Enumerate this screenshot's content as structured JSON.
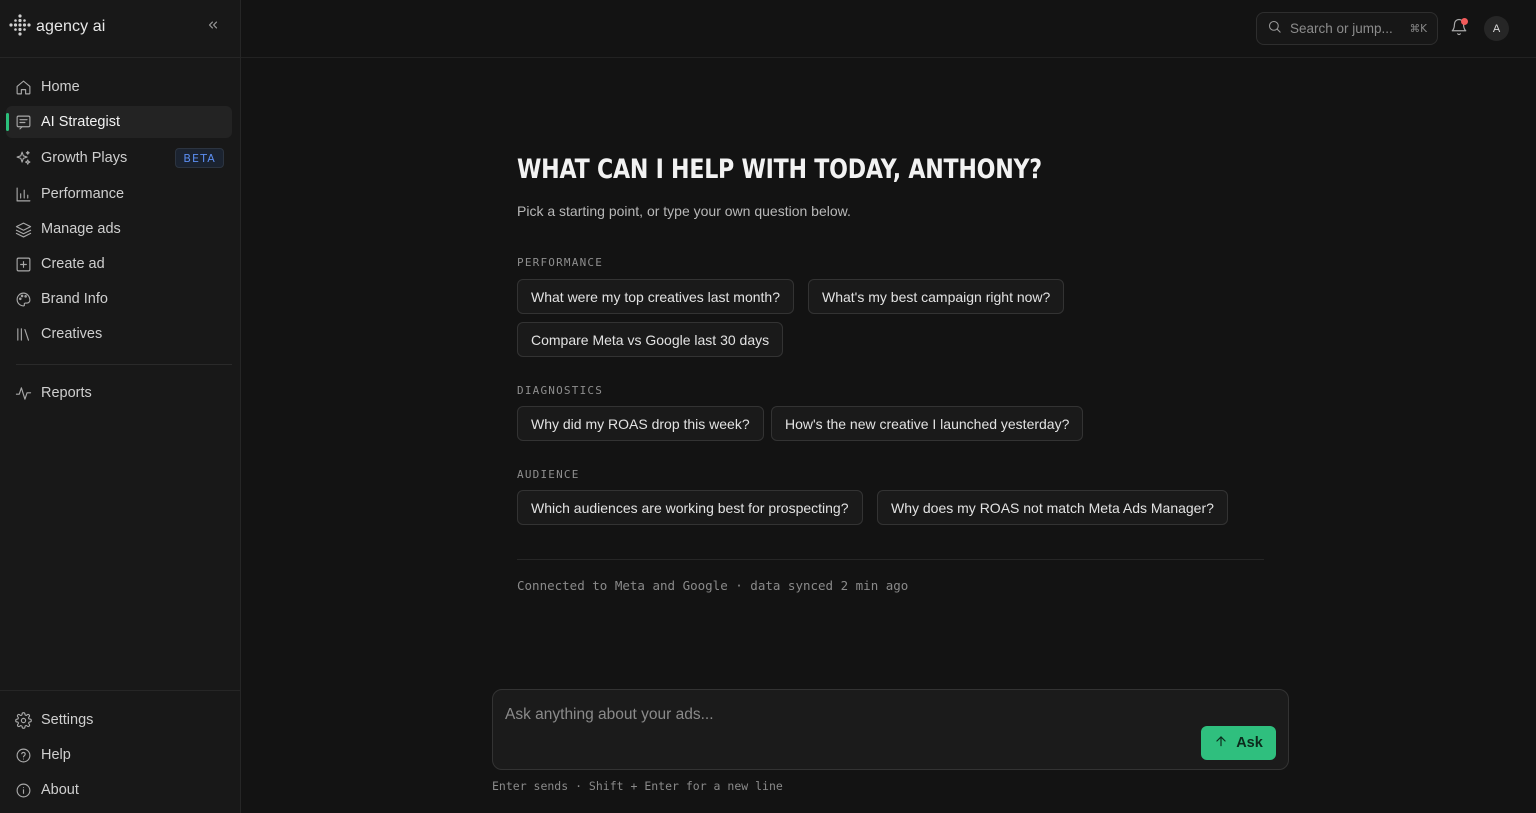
{
  "brand": {
    "name": "agency ai",
    "logo_icon": "dots-grid-logo"
  },
  "sidebar": {
    "collapse_icon": "chevrons-left-icon",
    "items": [
      {
        "label": "Home",
        "icon": "home-icon"
      },
      {
        "label": "AI Strategist",
        "icon": "chat-icon",
        "active": true
      },
      {
        "label": "Growth Plays",
        "icon": "sparkles-icon",
        "badge": "BETA"
      },
      {
        "label": "Performance",
        "icon": "bar-chart-icon"
      },
      {
        "label": "Manage ads",
        "icon": "layers-icon"
      },
      {
        "label": "Create ad",
        "icon": "plus-square-icon"
      },
      {
        "label": "Brand Info",
        "icon": "palette-icon"
      },
      {
        "label": "Creatives",
        "icon": "library-icon"
      },
      {
        "label": "Reports",
        "icon": "activity-icon"
      }
    ],
    "footer_items": [
      {
        "label": "Settings",
        "icon": "gear-icon"
      },
      {
        "label": "Help",
        "icon": "help-circle-icon"
      },
      {
        "label": "About",
        "icon": "info-icon"
      }
    ]
  },
  "topbar": {
    "search_placeholder": "Search or jump...",
    "search_shortcut": "⌘K",
    "avatar_initial": "A"
  },
  "main": {
    "heading": "WHAT CAN I HELP WITH TODAY, ANTHONY?",
    "subheading": "Pick a starting point, or type your own question below.",
    "sections": [
      {
        "label": "PERFORMANCE",
        "prompts": [
          "What were my top creatives last month?",
          "What's my best campaign right now?",
          "Compare Meta vs Google last 30 days"
        ]
      },
      {
        "label": "DIAGNOSTICS",
        "prompts": [
          "Why did my ROAS drop this week?",
          "How's the new creative I launched yesterday?"
        ]
      },
      {
        "label": "AUDIENCE",
        "prompts": [
          "Which audiences are working best for prospecting?",
          "Why does my ROAS not match Meta Ads Manager?"
        ]
      }
    ],
    "status": "Connected to Meta and Google · data synced 2 min ago",
    "composer": {
      "placeholder": "Ask anything about your ads...",
      "value": "",
      "submit_label": "Ask",
      "hint": "Enter sends · Shift + Enter for a new line"
    }
  },
  "colors": {
    "accent": "#2fbf7e",
    "background": "#131313",
    "sidebar_bg": "#181818",
    "beta_badge": "#5b8df0",
    "notification_dot": "#f25a5a"
  }
}
